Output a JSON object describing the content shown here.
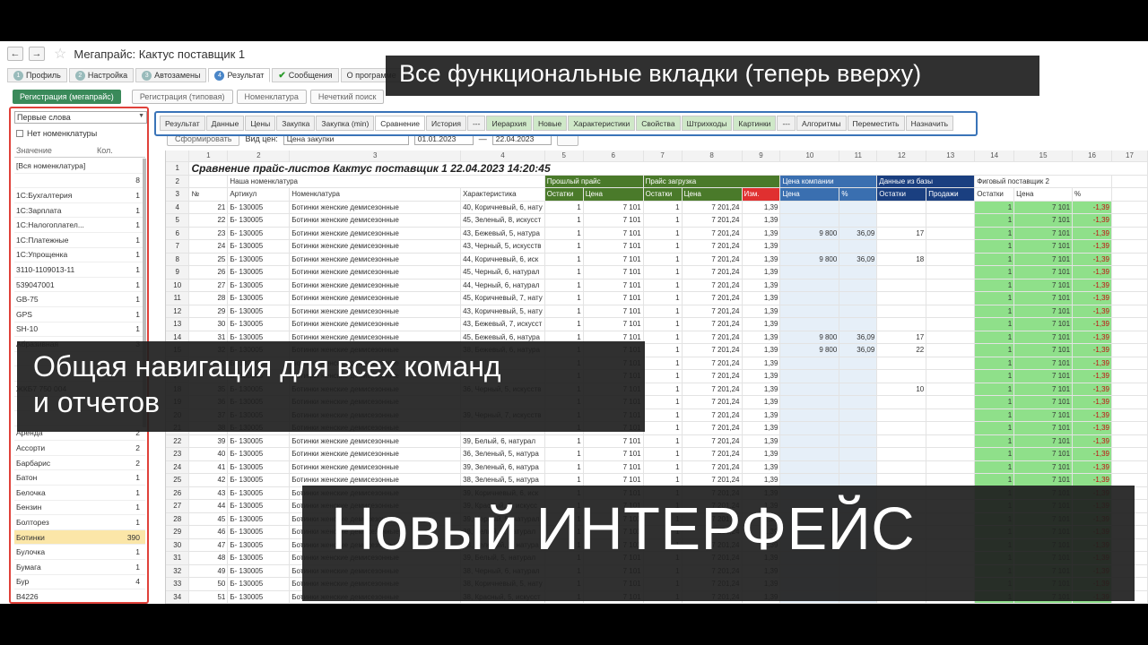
{
  "window": {
    "title": "Мегапрайс: Кактус поставщик 1",
    "back": "←",
    "forward": "→",
    "star": "☆"
  },
  "top_tabs": [
    {
      "num": "1",
      "label": "Профиль",
      "icon": "num"
    },
    {
      "num": "2",
      "label": "Настройка",
      "icon": "num"
    },
    {
      "num": "3",
      "label": "Автозамены",
      "icon": "num"
    },
    {
      "num": "4",
      "label": "Результат",
      "icon": "num-blue",
      "active": true
    },
    {
      "num": "",
      "label": "Сообщения",
      "icon": "check"
    },
    {
      "num": "",
      "label": "О программе",
      "icon": "none"
    }
  ],
  "actions": {
    "register": "Регистрация (мегапрайс)",
    "register2": "Регистрация (типовая)",
    "nomenclature": "Номенклатура",
    "search": "Нечеткий поиск"
  },
  "sidebar": {
    "select_value": "Первые слова",
    "checkbox_label": "Нет номенклатуры",
    "col_value": "Значение",
    "col_count": "Кол.",
    "items": [
      {
        "label": "[Вся номенклатура]",
        "count": ""
      },
      {
        "label": "",
        "count": "8"
      },
      {
        "label": "1С:Бухгалтерия",
        "count": "1"
      },
      {
        "label": "1С:Зарплата",
        "count": "1"
      },
      {
        "label": "1С:Налогоплател...",
        "count": "1"
      },
      {
        "label": "1С:Платежные",
        "count": "1"
      },
      {
        "label": "1С:Упрощенка",
        "count": "1"
      },
      {
        "label": "3110-1109013-11",
        "count": "1"
      },
      {
        "label": "539047001",
        "count": "1"
      },
      {
        "label": "GB-75",
        "count": "1"
      },
      {
        "label": "GPS",
        "count": "1"
      },
      {
        "label": "SH-10",
        "count": "1"
      },
      {
        "label": "Абразивная",
        "count": "3"
      },
      {
        "label": "",
        "count": ""
      },
      {
        "label": "",
        "count": ""
      },
      {
        "label": "ЖКБ7 750 004",
        "count": ""
      },
      {
        "label": "",
        "count": ""
      },
      {
        "label": "",
        "count": ""
      },
      {
        "label": "Аренда",
        "count": "2"
      },
      {
        "label": "Ассорти",
        "count": "2"
      },
      {
        "label": "Барбарис",
        "count": "2"
      },
      {
        "label": "Батон",
        "count": "1"
      },
      {
        "label": "Белочка",
        "count": "1"
      },
      {
        "label": "Бензин",
        "count": "1"
      },
      {
        "label": "Болторез",
        "count": "1"
      },
      {
        "label": "Ботинки",
        "count": "390",
        "selected": true
      },
      {
        "label": "Булочка",
        "count": "1"
      },
      {
        "label": "Бумага",
        "count": "1"
      },
      {
        "label": "Бур",
        "count": "4"
      },
      {
        "label": "В4226",
        "count": ""
      }
    ]
  },
  "panel_tabs": [
    {
      "label": "Результат"
    },
    {
      "label": "Данные"
    },
    {
      "label": "Цены"
    },
    {
      "label": "Закупка"
    },
    {
      "label": "Закупка (min)"
    },
    {
      "label": "Сравнение",
      "selected": true
    },
    {
      "label": "История"
    },
    {
      "label": "---"
    },
    {
      "label": "Иерархия",
      "green": true
    },
    {
      "label": "Новые",
      "green": true
    },
    {
      "label": "Характеристики",
      "green": true
    },
    {
      "label": "Свойства",
      "green": true
    },
    {
      "label": "Штрихкоды",
      "green": true
    },
    {
      "label": "Картинки",
      "green": true
    },
    {
      "label": "---"
    },
    {
      "label": "Алгоритмы"
    },
    {
      "label": "Переместить"
    },
    {
      "label": "Назначить"
    }
  ],
  "toolbar": {
    "form_btn": "Сформировать",
    "kind_label": "Вид цен:",
    "kind_value": "Цена закупки",
    "date_from": "01.01.2023",
    "date_to": "22.04.2023",
    "dash": "—"
  },
  "grid": {
    "col_numbers": [
      "",
      "1",
      "2",
      "3",
      "4",
      "5",
      "6",
      "7",
      "8",
      "9",
      "10",
      "11",
      "12",
      "13",
      "14",
      "15",
      "16",
      "17"
    ],
    "title": "Сравнение прайс-листов Кактус поставщик 1 22.04.2023 14:20:45",
    "h2": {
      "our": "Наша номенклатура",
      "past": "Прошлый прайс",
      "load": "Прайс загрузка",
      "company": "Цена компании",
      "base": "Данные из базы",
      "fig": "Фиговый поставщик 2"
    },
    "h3": {
      "no": "№",
      "art": "Артикул",
      "nom": "Номенклатура",
      "char": "Характеристика",
      "ost1": "Остатки",
      "price1": "Цена",
      "ost2": "Остатки",
      "price2": "Цена",
      "chg": "Изм.",
      "cprice": "Цена",
      "pct": "%",
      "bost": "Остатки",
      "bsale": "Продажи",
      "fost": "Остатки",
      "fprice": "Цена",
      "fpct": "%"
    },
    "rows": [
      {
        "r": "4",
        "n": "21",
        "art": "Б- 130005",
        "nom": "Ботинки женские демисезонные",
        "ch": "40, Коричневый, 6, нату",
        "o1": "1",
        "p1": "7 101",
        "o2": "1",
        "p2": "7 201,24",
        "d": "1,39",
        "cp": "",
        "pc": "",
        "bo": "",
        "bs": "",
        "fo": "1",
        "fp": "7 101",
        "fpc": "-1,39"
      },
      {
        "r": "5",
        "n": "22",
        "art": "Б- 130005",
        "nom": "Ботинки женские демисезонные",
        "ch": "45, Зеленый, 8, искусст",
        "o1": "1",
        "p1": "7 101",
        "o2": "1",
        "p2": "7 201,24",
        "d": "1,39",
        "cp": "",
        "pc": "",
        "bo": "",
        "bs": "",
        "fo": "1",
        "fp": "7 101",
        "fpc": "-1,39"
      },
      {
        "r": "6",
        "n": "23",
        "art": "Б- 130005",
        "nom": "Ботинки женские демисезонные",
        "ch": "43, Бежевый, 5, натура",
        "o1": "1",
        "p1": "7 101",
        "o2": "1",
        "p2": "7 201,24",
        "d": "1,39",
        "cp": "9 800",
        "pc": "36,09",
        "bo": "17",
        "bs": "",
        "fo": "1",
        "fp": "7 101",
        "fpc": "-1,39"
      },
      {
        "r": "7",
        "n": "24",
        "art": "Б- 130005",
        "nom": "Ботинки женские демисезонные",
        "ch": "43, Черный, 5, искусств",
        "o1": "1",
        "p1": "7 101",
        "o2": "1",
        "p2": "7 201,24",
        "d": "1,39",
        "cp": "",
        "pc": "",
        "bo": "",
        "bs": "",
        "fo": "1",
        "fp": "7 101",
        "fpc": "-1,39"
      },
      {
        "r": "8",
        "n": "25",
        "art": "Б- 130005",
        "nom": "Ботинки женские демисезонные",
        "ch": "44, Коричневый, 6, иск",
        "o1": "1",
        "p1": "7 101",
        "o2": "1",
        "p2": "7 201,24",
        "d": "1,39",
        "cp": "9 800",
        "pc": "36,09",
        "bo": "18",
        "bs": "",
        "fo": "1",
        "fp": "7 101",
        "fpc": "-1,39"
      },
      {
        "r": "9",
        "n": "26",
        "art": "Б- 130005",
        "nom": "Ботинки женские демисезонные",
        "ch": "45, Черный, 6, натурал",
        "o1": "1",
        "p1": "7 101",
        "o2": "1",
        "p2": "7 201,24",
        "d": "1,39",
        "cp": "",
        "pc": "",
        "bo": "",
        "bs": "",
        "fo": "1",
        "fp": "7 101",
        "fpc": "-1,39"
      },
      {
        "r": "10",
        "n": "27",
        "art": "Б- 130005",
        "nom": "Ботинки женские демисезонные",
        "ch": "44, Черный, 6, натурал",
        "o1": "1",
        "p1": "7 101",
        "o2": "1",
        "p2": "7 201,24",
        "d": "1,39",
        "cp": "",
        "pc": "",
        "bo": "",
        "bs": "",
        "fo": "1",
        "fp": "7 101",
        "fpc": "-1,39"
      },
      {
        "r": "11",
        "n": "28",
        "art": "Б- 130005",
        "nom": "Ботинки женские демисезонные",
        "ch": "45, Коричневый, 7, нату",
        "o1": "1",
        "p1": "7 101",
        "o2": "1",
        "p2": "7 201,24",
        "d": "1,39",
        "cp": "",
        "pc": "",
        "bo": "",
        "bs": "",
        "fo": "1",
        "fp": "7 101",
        "fpc": "-1,39"
      },
      {
        "r": "12",
        "n": "29",
        "art": "Б- 130005",
        "nom": "Ботинки женские демисезонные",
        "ch": "43, Коричневый, 5, нату",
        "o1": "1",
        "p1": "7 101",
        "o2": "1",
        "p2": "7 201,24",
        "d": "1,39",
        "cp": "",
        "pc": "",
        "bo": "",
        "bs": "",
        "fo": "1",
        "fp": "7 101",
        "fpc": "-1,39"
      },
      {
        "r": "13",
        "n": "30",
        "art": "Б- 130005",
        "nom": "Ботинки женские демисезонные",
        "ch": "43, Бежевый, 7, искусст",
        "o1": "1",
        "p1": "7 101",
        "o2": "1",
        "p2": "7 201,24",
        "d": "1,39",
        "cp": "",
        "pc": "",
        "bo": "",
        "bs": "",
        "fo": "1",
        "fp": "7 101",
        "fpc": "-1,39"
      },
      {
        "r": "14",
        "n": "31",
        "art": "Б- 130005",
        "nom": "Ботинки женские демисезонные",
        "ch": "45, Бежевый, 6, натура",
        "o1": "1",
        "p1": "7 101",
        "o2": "1",
        "p2": "7 201,24",
        "d": "1,39",
        "cp": "9 800",
        "pc": "36,09",
        "bo": "17",
        "bs": "",
        "fo": "1",
        "fp": "7 101",
        "fpc": "-1,39"
      },
      {
        "r": "15",
        "n": "32",
        "art": "Б- 130005",
        "nom": "Ботинки женские демисезонные",
        "ch": "38, Бежевый, 6, натура",
        "o1": "1",
        "p1": "7 101",
        "o2": "1",
        "p2": "7 201,24",
        "d": "1,39",
        "cp": "9 800",
        "pc": "36,09",
        "bo": "22",
        "bs": "",
        "fo": "1",
        "fp": "7 101",
        "fpc": "-1,39"
      },
      {
        "r": "16",
        "n": "33",
        "art": "Б- 130005",
        "nom": "Ботинки женские демисезонные",
        "ch": "",
        "o1": "1",
        "p1": "7 101",
        "o2": "1",
        "p2": "7 201,24",
        "d": "1,39",
        "cp": "",
        "pc": "",
        "bo": "",
        "bs": "",
        "fo": "1",
        "fp": "7 101",
        "fpc": "-1,39"
      },
      {
        "r": "17",
        "n": "34",
        "art": "Б- 130005",
        "nom": "Ботинки женские демисезонные",
        "ch": "",
        "o1": "1",
        "p1": "7 101",
        "o2": "1",
        "p2": "7 201,24",
        "d": "1,39",
        "cp": "",
        "pc": "",
        "bo": "",
        "bs": "",
        "fo": "1",
        "fp": "7 101",
        "fpc": "-1,39"
      },
      {
        "r": "18",
        "n": "35",
        "art": "Б- 130005",
        "nom": "Ботинки женские демисезонные",
        "ch": "36, Черный, 5, искусств",
        "o1": "1",
        "p1": "7 101",
        "o2": "1",
        "p2": "7 201,24",
        "d": "1,39",
        "cp": "",
        "pc": "",
        "bo": "10",
        "bs": "",
        "fo": "1",
        "fp": "7 101",
        "fpc": "-1,39"
      },
      {
        "r": "19",
        "n": "36",
        "art": "Б- 130005",
        "nom": "Ботинки женские демисезонные",
        "ch": "",
        "o1": "1",
        "p1": "7 101",
        "o2": "1",
        "p2": "7 201,24",
        "d": "1,39",
        "cp": "",
        "pc": "",
        "bo": "",
        "bs": "",
        "fo": "1",
        "fp": "7 101",
        "fpc": "-1,39"
      },
      {
        "r": "20",
        "n": "37",
        "art": "Б- 130005",
        "nom": "Ботинки женские демисезонные",
        "ch": "39, Черный, 7, искусств",
        "o1": "1",
        "p1": "7 101",
        "o2": "1",
        "p2": "7 201,24",
        "d": "1,39",
        "cp": "",
        "pc": "",
        "bo": "",
        "bs": "",
        "fo": "1",
        "fp": "7 101",
        "fpc": "-1,39"
      },
      {
        "r": "21",
        "n": "38",
        "art": "Б- 130005",
        "nom": "Ботинки женские демисезонные",
        "ch": "",
        "o1": "1",
        "p1": "7 101",
        "o2": "1",
        "p2": "7 201,24",
        "d": "1,39",
        "cp": "",
        "pc": "",
        "bo": "",
        "bs": "",
        "fo": "1",
        "fp": "7 101",
        "fpc": "-1,39"
      },
      {
        "r": "22",
        "n": "39",
        "art": "Б- 130005",
        "nom": "Ботинки женские демисезонные",
        "ch": "39, Белый, 6, натурал",
        "o1": "1",
        "p1": "7 101",
        "o2": "1",
        "p2": "7 201,24",
        "d": "1,39",
        "cp": "",
        "pc": "",
        "bo": "",
        "bs": "",
        "fo": "1",
        "fp": "7 101",
        "fpc": "-1,39"
      },
      {
        "r": "23",
        "n": "40",
        "art": "Б- 130005",
        "nom": "Ботинки женские демисезонные",
        "ch": "36, Зеленый, 5, натура",
        "o1": "1",
        "p1": "7 101",
        "o2": "1",
        "p2": "7 201,24",
        "d": "1,39",
        "cp": "",
        "pc": "",
        "bo": "",
        "bs": "",
        "fo": "1",
        "fp": "7 101",
        "fpc": "-1,39"
      },
      {
        "r": "24",
        "n": "41",
        "art": "Б- 130005",
        "nom": "Ботинки женские демисезонные",
        "ch": "39, Зеленый, 6, натура",
        "o1": "1",
        "p1": "7 101",
        "o2": "1",
        "p2": "7 201,24",
        "d": "1,39",
        "cp": "",
        "pc": "",
        "bo": "",
        "bs": "",
        "fo": "1",
        "fp": "7 101",
        "fpc": "-1,39"
      },
      {
        "r": "25",
        "n": "42",
        "art": "Б- 130005",
        "nom": "Ботинки женские демисезонные",
        "ch": "38, Зеленый, 5, натура",
        "o1": "1",
        "p1": "7 101",
        "o2": "1",
        "p2": "7 201,24",
        "d": "1,39",
        "cp": "",
        "pc": "",
        "bo": "",
        "bs": "",
        "fo": "1",
        "fp": "7 101",
        "fpc": "-1,39"
      },
      {
        "r": "26",
        "n": "43",
        "art": "Б- 130005",
        "nom": "Ботинки женские демисезонные",
        "ch": "39, Коричневый, 6, иск",
        "o1": "1",
        "p1": "7 101",
        "o2": "1",
        "p2": "7 201,24",
        "d": "1,39",
        "cp": "",
        "pc": "",
        "bo": "",
        "bs": "",
        "fo": "1",
        "fp": "7 101",
        "fpc": "-1,39"
      },
      {
        "r": "27",
        "n": "44",
        "art": "Б- 130005",
        "nom": "Ботинки женские демисезонные",
        "ch": "39, Красный, 6, искусс",
        "o1": "1",
        "p1": "7 101",
        "o2": "1",
        "p2": "7 201,24",
        "d": "1,39",
        "cp": "",
        "pc": "",
        "bo": "",
        "bs": "",
        "fo": "1",
        "fp": "7 101",
        "fpc": "-1,39"
      },
      {
        "r": "28",
        "n": "45",
        "art": "Б- 130005",
        "nom": "Ботинки женские демисезонные",
        "ch": "39, Черный, 5, натурал",
        "o1": "1",
        "p1": "7 101",
        "o2": "1",
        "p2": "7 201,24",
        "d": "1,39",
        "cp": "",
        "pc": "",
        "bo": "",
        "bs": "",
        "fo": "1",
        "fp": "7 101",
        "fpc": "-1,39"
      },
      {
        "r": "29",
        "n": "46",
        "art": "Б- 130005",
        "nom": "Ботинки женские демисезонные",
        "ch": "38, Белый, 7, натурал",
        "o1": "1",
        "p1": "7 101",
        "o2": "1",
        "p2": "7 201,24",
        "d": "1,39",
        "cp": "",
        "pc": "",
        "bo": "",
        "bs": "",
        "fo": "1",
        "fp": "7 101",
        "fpc": "-1,39"
      },
      {
        "r": "30",
        "n": "47",
        "art": "Б- 130005",
        "nom": "Ботинки женские демисезонные",
        "ch": "38, Зеленый, 5, натура",
        "o1": "1",
        "p1": "7 101",
        "o2": "1",
        "p2": "7 201,24",
        "d": "1,39",
        "cp": "",
        "pc": "",
        "bo": "",
        "bs": "",
        "fo": "1",
        "fp": "7 101",
        "fpc": "-1,39"
      },
      {
        "r": "31",
        "n": "48",
        "art": "Б- 130005",
        "nom": "Ботинки женские демисезонные",
        "ch": "39, Белый, 5, натурал",
        "o1": "1",
        "p1": "7 101",
        "o2": "1",
        "p2": "7 201,24",
        "d": "1,39",
        "cp": "",
        "pc": "",
        "bo": "",
        "bs": "",
        "fo": "1",
        "fp": "7 101",
        "fpc": "-1,39"
      },
      {
        "r": "32",
        "n": "49",
        "art": "Б- 130005",
        "nom": "Ботинки женские демисезонные",
        "ch": "38, Черный, 6, натурал",
        "o1": "1",
        "p1": "7 101",
        "o2": "1",
        "p2": "7 201,24",
        "d": "1,39",
        "cp": "",
        "pc": "",
        "bo": "",
        "bs": "",
        "fo": "1",
        "fp": "7 101",
        "fpc": "-1,39"
      },
      {
        "r": "33",
        "n": "50",
        "art": "Б- 130005",
        "nom": "Ботинки женские демисезонные",
        "ch": "38, Коричневый, 5, нату",
        "o1": "1",
        "p1": "7 101",
        "o2": "1",
        "p2": "7 201,24",
        "d": "1,39",
        "cp": "",
        "pc": "",
        "bo": "",
        "bs": "",
        "fo": "1",
        "fp": "7 101",
        "fpc": "-1,39"
      },
      {
        "r": "34",
        "n": "51",
        "art": "Б- 130005",
        "nom": "Ботинки женские демисезонные",
        "ch": "38, Красный, 5, искусст",
        "o1": "1",
        "p1": "7 101",
        "o2": "1",
        "p2": "7 201,24",
        "d": "1,39",
        "cp": "",
        "pc": "",
        "bo": "",
        "bs": "",
        "fo": "1",
        "fp": "7 101",
        "fpc": "-1,39"
      }
    ]
  },
  "overlays": {
    "tabs_caption": "Все функциональные вкладки (теперь вверху)",
    "nav_caption_1": "Общая навигация для всех команд",
    "nav_caption_2": "и отчетов",
    "headline": "Новый ИНТЕРФЕЙС"
  },
  "colors": {
    "sidebar_frame": "#e0413a",
    "tabs_frame": "#3a74b8",
    "fig_column": "#8fe08a",
    "selected_row": "#fbe6a8"
  }
}
